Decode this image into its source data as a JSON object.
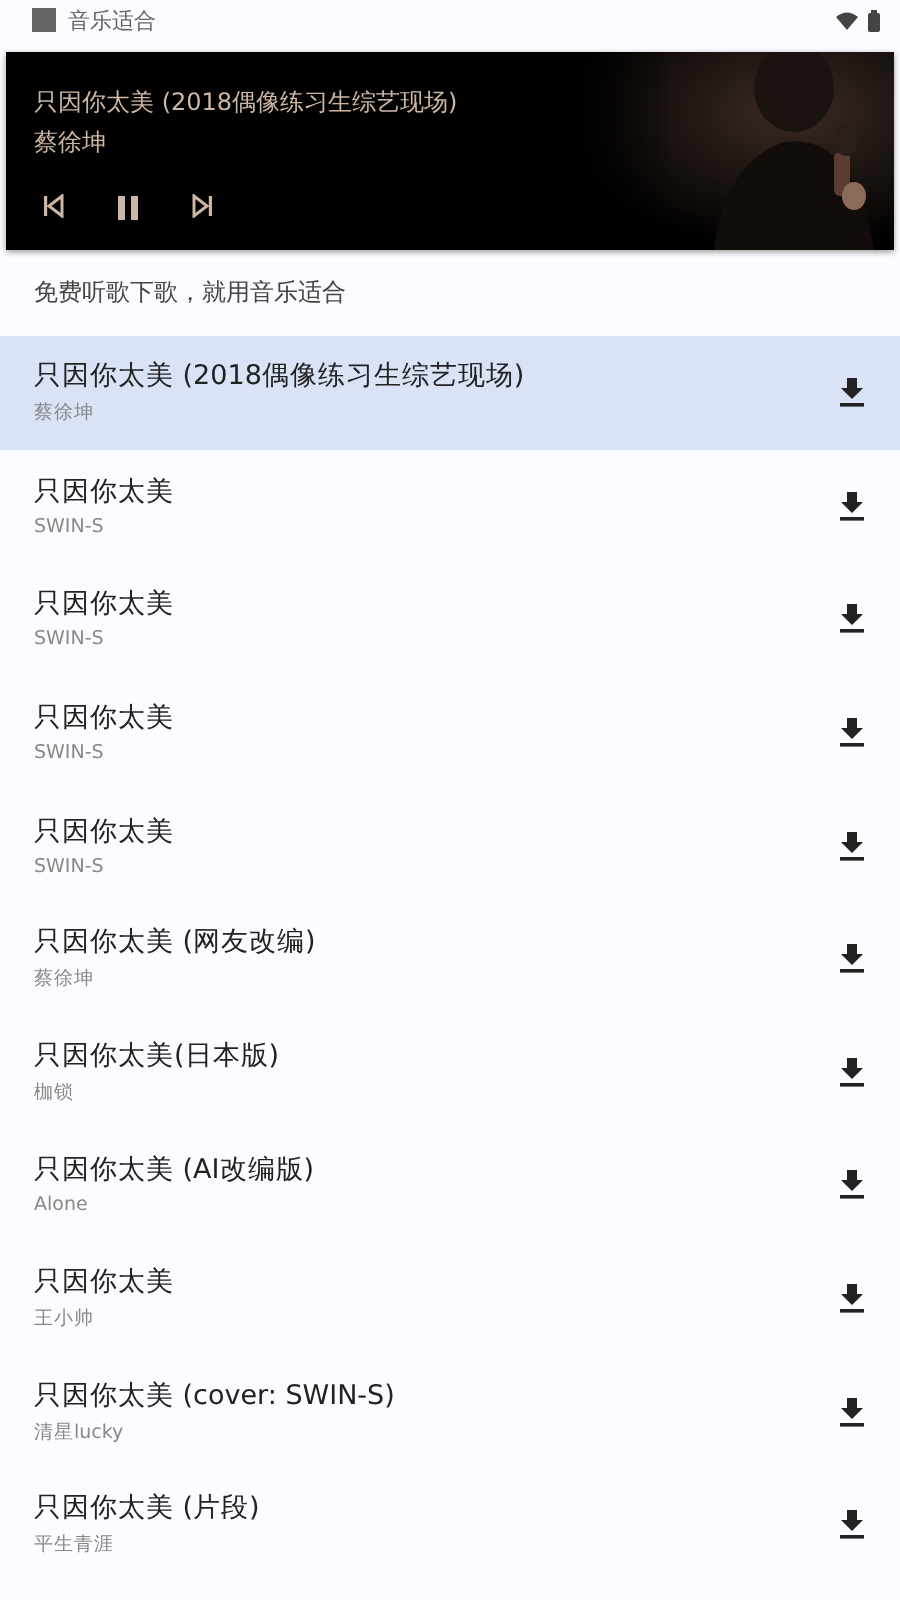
{
  "status_bar": {
    "app_name": "音乐适合"
  },
  "media_notification": {
    "title": "只因你太美 (2018偶像练习生综艺现场)",
    "artist": "蔡徐坤",
    "playing": true
  },
  "subtitle": "免费听歌下歌，就用音乐适合",
  "songs": [
    {
      "title": "只因你太美 (2018偶像练习生综艺现场)",
      "artist": "蔡徐坤",
      "selected": true
    },
    {
      "title": "只因你太美",
      "artist": "SWIN-S",
      "selected": false
    },
    {
      "title": "只因你太美",
      "artist": "SWIN-S",
      "selected": false
    },
    {
      "title": "只因你太美",
      "artist": "SWIN-S",
      "selected": false
    },
    {
      "title": "只因你太美",
      "artist": "SWIN-S",
      "selected": false
    },
    {
      "title": "只因你太美 (网友改编)",
      "artist": "蔡徐坤",
      "selected": false
    },
    {
      "title": "只因你太美(日本版)",
      "artist": "枷锁",
      "selected": false
    },
    {
      "title": "只因你太美 (AI改编版)",
      "artist": "Alone",
      "selected": false
    },
    {
      "title": "只因你太美",
      "artist": "王小帅",
      "selected": false
    },
    {
      "title": "只因你太美 (cover: SWIN-S)",
      "artist": "清星lucky",
      "selected": false
    },
    {
      "title": "只因你太美 (片段)",
      "artist": "平生青涯",
      "selected": false
    }
  ]
}
